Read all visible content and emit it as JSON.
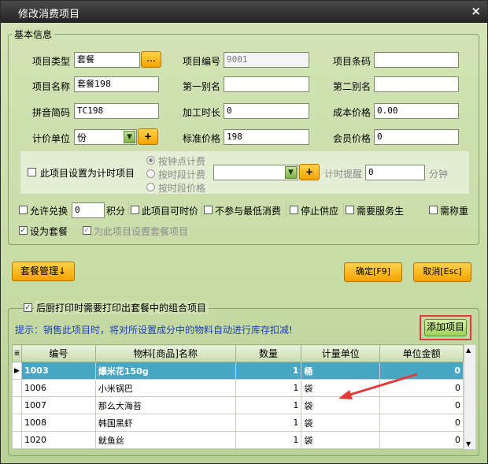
{
  "window": {
    "title": "修改消费项目",
    "close_glyph": "×"
  },
  "basic": {
    "group_title": "基本信息",
    "item_type_label": "项目类型",
    "item_type_value": "套餐",
    "ellipsis_label": "...",
    "item_no_label": "项目编号",
    "item_no_value": "9001",
    "barcode_label": "项目条码",
    "barcode_value": "",
    "item_name_label": "项目名称",
    "item_name_value": "套餐198",
    "alias1_label": "第一别名",
    "alias1_value": "",
    "alias2_label": "第二别名",
    "alias2_value": "",
    "pinyin_label": "拼音简码",
    "pinyin_value": "TC198",
    "proc_time_label": "加工时长",
    "proc_time_value": "0",
    "cost_label": "成本价格",
    "cost_value": "0.00",
    "unit_label": "计价单位",
    "unit_value": "份",
    "plus_label": "+",
    "std_price_label": "标准价格",
    "std_price_value": "198",
    "member_price_label": "会员价格",
    "member_price_value": "0"
  },
  "timed": {
    "checkbox_label": "此项目设置为计时项目",
    "radio_per_hour": "按钟点计费",
    "radio_per_period": "按时段计费",
    "radio_period_price": "按时段价格",
    "dropdown_value": "",
    "plus_label": "+",
    "reminder_label": "计时提醒",
    "reminder_value": "0",
    "minutes_label": "分钟"
  },
  "options": {
    "allow_exchange_label": "允许兑换",
    "exchange_value": "0",
    "points_label": "积分",
    "time_price_label": "此项目可时价",
    "no_min_consume_label": "不参与最低消费",
    "stop_supply_label": "停止供应",
    "need_service_label": "需要服务生",
    "need_weigh_label": "需称重",
    "set_package_label": "设为套餐",
    "set_package_items_label": "为此项目设置套餐项目"
  },
  "buttons": {
    "package_manage": "套餐管理↓",
    "confirm": "确定[F9]",
    "cancel": "取消[Esc]",
    "add_item": "添加项目"
  },
  "package": {
    "print_label": "后厨打印时需要打印出套餐中的组合项目",
    "hint": "提示：销售此项目时，将对所设置成分中的物料自动进行库存扣减!",
    "columns": [
      "编号",
      "物料[商品]名称",
      "数量",
      "计量单位",
      "单位金额"
    ],
    "rows": [
      {
        "code": "1003",
        "name": "爆米花150g",
        "qty": "1",
        "unit": "桶",
        "price": "0"
      },
      {
        "code": "1006",
        "name": "小米锅巴",
        "qty": "1",
        "unit": "袋",
        "price": "0"
      },
      {
        "code": "1007",
        "name": "那么大海苔",
        "qty": "1",
        "unit": "袋",
        "price": "0"
      },
      {
        "code": "1008",
        "name": "韩国黑虾",
        "qty": "1",
        "unit": "袋",
        "price": "0"
      },
      {
        "code": "1020",
        "name": "鱿鱼丝",
        "qty": "1",
        "unit": "袋",
        "price": "0"
      }
    ]
  },
  "colors": {
    "accent_orange": "#f4a300",
    "highlight_red": "#e23b3b",
    "selected_row": "#4aa7c4",
    "hint_blue": "#1f3fbf"
  }
}
